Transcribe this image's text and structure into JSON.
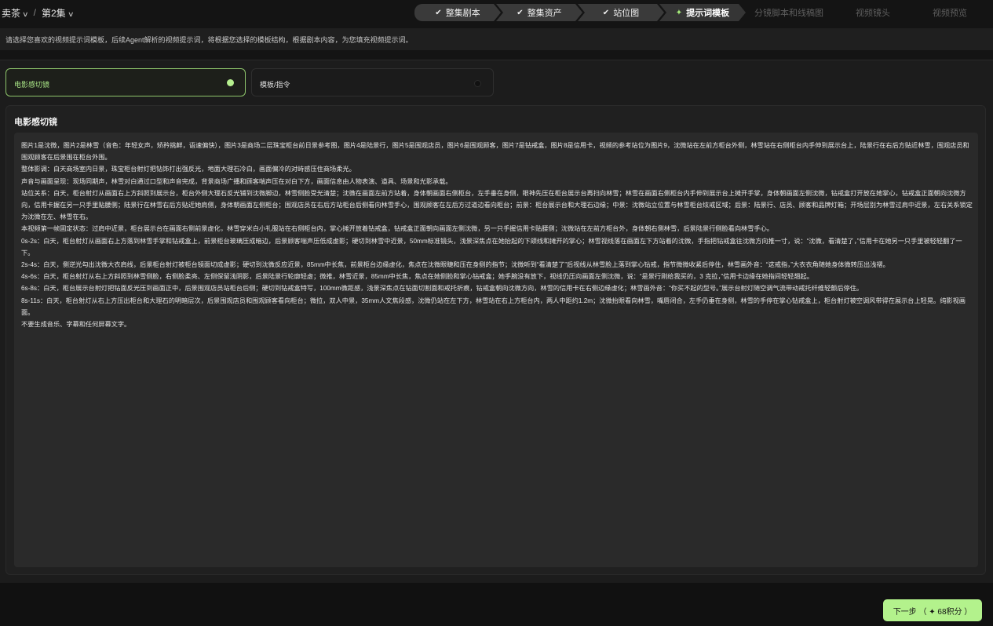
{
  "breadcrumb": {
    "project": "卖茶",
    "episode": "第2集"
  },
  "steps": [
    {
      "label": "整集剧本",
      "state": "done"
    },
    {
      "label": "整集资产",
      "state": "done"
    },
    {
      "label": "站位图",
      "state": "done"
    },
    {
      "label": "提示词模板",
      "state": "active"
    },
    {
      "label": "分镜脚本和线稿图",
      "state": "future"
    },
    {
      "label": "视频镜头",
      "state": "future"
    },
    {
      "label": "视频预览",
      "state": "future"
    }
  ],
  "hint": "请选择您喜欢的视频提示词模板，后续Agent解析的视频提示词，将根据您选择的模板结构，根据剧本内容，为您填充视频提示词。",
  "templates": [
    {
      "label": "电影感切镜",
      "selected": true
    },
    {
      "label": "模板/指令",
      "selected": false
    }
  ],
  "editor": {
    "title": "电影感切镜",
    "lines": [
      "图片1是沈微，图片2是林雪（音色：年轻女声，矫矜挑衅，语速偏快），图片3是商场二层珠宝柜台前日景参考图，图片4是陆景行，图片5是围观店员，图片6是围观顾客，图片7是钻戒盒，图片8是信用卡，视频的参考站位为图片9，沈微站在左前方柜台外侧，林雪站在右侧柜台内手伸到展示台上，陆景行在右后方贴近林雪，围观店员和围观顾客在后景围在柜台外围。",
      "整体影调：白天商场室内日景，珠宝柜台射灯把钻饰打出强反光，地面大理石冷白，画面偏冷的对峙感压住商场柔光。",
      "声音与画面呈现：现场同期声，林雪对白通过口型和声音完成，背景商场广播和顾客喘声压在对白下方，画面信息由人物表演、道具、场景和光影承载。",
      "站位关系：白天，柜台射灯从画面右上方斜照到展示台，柜台外侧大理石反光铺到沈微脚边，林雪侧脸受光清楚；沈微在画面左前方站着，身体朝画面右侧柜台，左手垂在身侧，眼神先压在柜台展示台再扫向林雪；林雪在画面右侧柜台内手伸到展示台上摊开手掌，身体朝画面左侧沈微，钻戒盒打开放在她掌心，钻戒盒正面朝向沈微方向，信用卡握在另一只手里贴腰侧；陆景行在林雪右后方贴近她肩侧，身体朝画面左侧柜台；围观店员在右后方站柜台后侧看向林雪手心，围观顾客在左后方过道边看向柜台；前景：柜台展示台和大理石边缘；中景：沈微站立位置与林雪柜台炫戒区域；后景：陆景行、店员、顾客和品牌灯箱；开场层别为林雪过肩中近景，左右关系锁定为沈微在左、林雪在右。",
      "本视频第一帧固定状态：过肩中近景，柜台展示台在画面右侧前景虚化，林雪穿米白小礼服站在右侧柜台内，掌心摊开放着钻戒盒，钻戒盒正面朝向画面左侧沈微，另一只手握信用卡贴腰侧；沈微站在左前方柜台外，身体朝右侧林雪，后景陆景行侧脸看向林雪手心。",
      "0s-2s：白天，柜台射灯从画面右上方落到林雪手掌和钻戒盒上，前景柜台玻璃压成暗边，后景顾客喘声压低成虚影；硬切到林雪中近景，50mm标准镜头，浅景深焦点在她抬起的下颌线和摊开的掌心；林雪视线落在画面左下方站着的沈微，手指把钻戒盒往沈微方向推一寸，说：“沈微，看清楚了，”信用卡在她另一只手里被轻轻翻了一下。",
      "2s-4s：白天，侧逆光勾出沈微大衣肩线，后景柜台射灯被柜台镜面切成虚影；硬切到沈微反应近景，85mm中长焦，前景柜台边缘虚化，焦点在沈微眼睫和压在身侧的指节；沈微听到“看清楚了”后视线从林雪脸上落到掌心钻戒，指节微微收紧后停住，林雪画外音：“这戒指，”大衣衣角随她身体微转压出浅褶。",
      "4s-6s：白天，柜台射灯从右上方斜照到林雪侧脸，右侧脸柔亮、左侧保留浅阴影，后景陆景行轮廓轻虚；微推，林雪近景，85mm中长焦，焦点在她侧脸和掌心钻戒盒；她手腕没有放下，视线仍压向画面左侧沈微，说：“是景行刚给我买的，3 克拉，”信用卡边缘在她指间轻轻翘起。",
      "6s-8s：白天，柜台展示台射灯把钻面反光压到画面正中，后景围观店员站柜台后侧；硬切到钻戒盒特写，100mm微距感，浅景深焦点在钻面切割面和戒托折痕，钻戒盒朝向沈微方向，林雪的信用卡在右侧边缘虚化；林雪画外音：“你买不起的型号。”展示台射灯随空调气流带动戒托纤维轻颤后停住。",
      "8s-11s：白天，柜台射灯从右上方压出柜台和大理石的明暗层次，后景围观店员和围观顾客看向柜台；微拉，双人中景，35mm人文焦段感，沈微仍站在左下方，林雪站在右上方柜台内，两人中距约1.2m；沈微抬眼看向林雪，嘴唇闭合，左手仍垂在身侧，林雪的手停在掌心钻戒盒上，柜台射灯被空调风带得在展示台上轻晃。纯影视画面。",
      "不要生成音乐、字幕和任何屏幕文字。"
    ]
  },
  "footer": {
    "next_label": "下一步 （ ✦ 68积分 ）"
  },
  "colors": {
    "accent": "#b3f28c",
    "background": "#141414",
    "panel": "#1c1c1c",
    "textbox": "#2a2a2a"
  }
}
